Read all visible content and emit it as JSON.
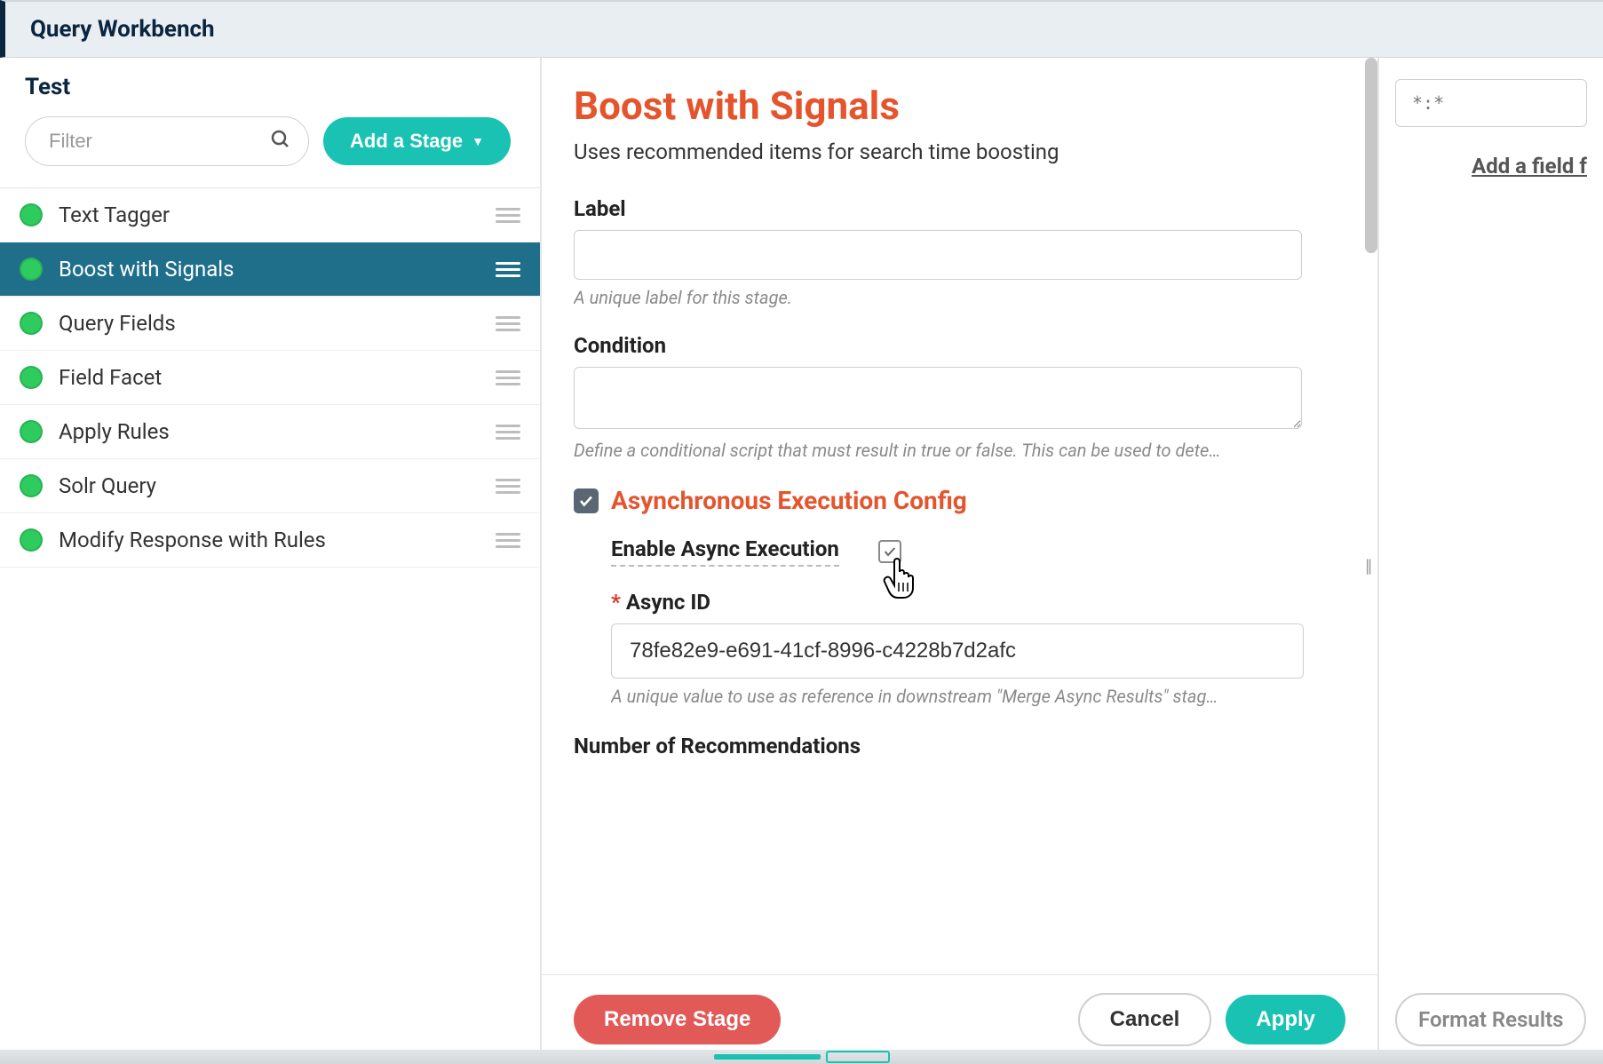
{
  "header": {
    "title": "Query Workbench"
  },
  "sidebar": {
    "title": "Test",
    "filter_placeholder": "Filter",
    "add_stage_label": "Add a Stage",
    "stages": [
      {
        "label": "Text Tagger",
        "active": false
      },
      {
        "label": "Boost with Signals",
        "active": true
      },
      {
        "label": "Query Fields",
        "active": false
      },
      {
        "label": "Field Facet",
        "active": false
      },
      {
        "label": "Apply Rules",
        "active": false
      },
      {
        "label": "Solr Query",
        "active": false
      },
      {
        "label": "Modify Response with Rules",
        "active": false
      }
    ]
  },
  "detail": {
    "title": "Boost with Signals",
    "subtitle": "Uses recommended items for search time boosting",
    "label_field": {
      "label": "Label",
      "value": "",
      "hint": "A unique label for this stage."
    },
    "condition_field": {
      "label": "Condition",
      "value": "",
      "hint": "Define a conditional script that must result in true or false. This can be used to dete…"
    },
    "async_section": {
      "title": "Asynchronous Execution Config",
      "enable_label": "Enable Async Execution",
      "enable_checked": true,
      "id_label": "Async ID",
      "id_value": "78fe82e9-e691-41cf-8996-c4228b7d2afc",
      "id_hint": "A unique value to use as reference in downstream \"Merge Async Results\" stag…"
    },
    "num_rec_label": "Number of Recommendations"
  },
  "footer": {
    "remove_label": "Remove Stage",
    "cancel_label": "Cancel",
    "apply_label": "Apply"
  },
  "right": {
    "query_value": "*:*",
    "add_field_label": "Add a field f",
    "format_label": "Format Results"
  }
}
